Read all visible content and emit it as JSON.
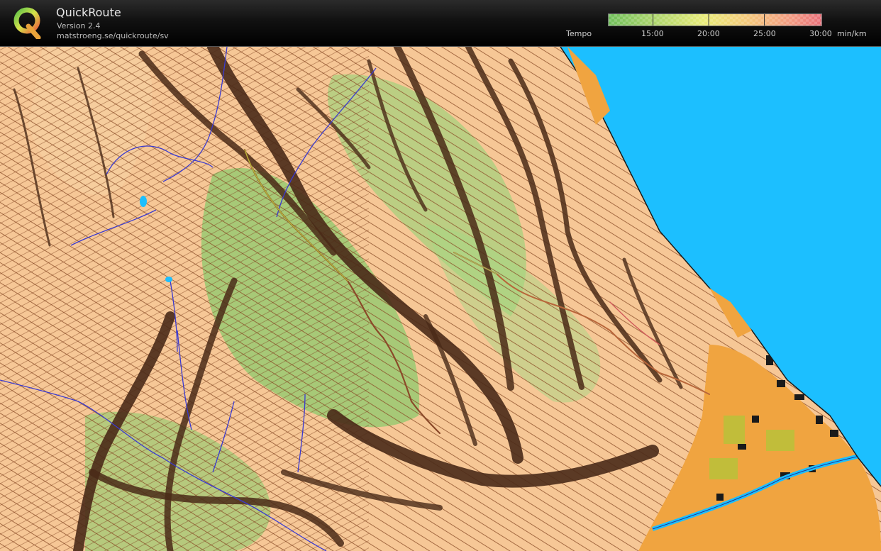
{
  "app": {
    "title": "QuickRoute",
    "version": "Version 2.4",
    "url": "matstroeng.se/quickroute/sv"
  },
  "legend": {
    "label": "Tempo",
    "ticks": [
      "15:00",
      "20:00",
      "25:00",
      "30:00"
    ],
    "unit": "min/km",
    "gradient_colors": [
      "#6fbf5a",
      "#a8d36a",
      "#e9ec78",
      "#f4c97a",
      "#f29b80",
      "#e8707a"
    ]
  },
  "map": {
    "colors": {
      "open_land": "#f6c796",
      "forest_green": "#8cc96c",
      "cliff": "#4a2a18",
      "contour": "#8a4a25",
      "water": "#1cbfff",
      "stream": "#3a3ad0",
      "village": "#f0a440",
      "route": "#8b4a2a"
    }
  }
}
